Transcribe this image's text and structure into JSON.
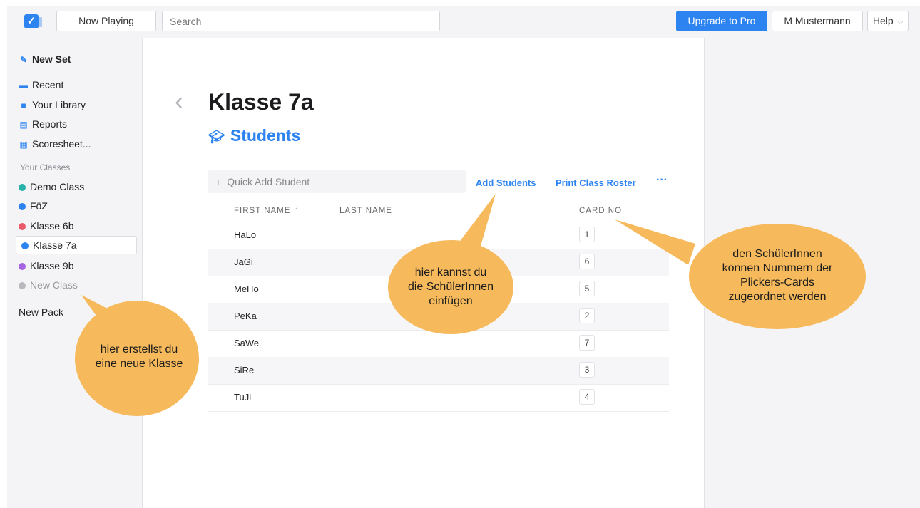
{
  "topbar": {
    "now_playing": "Now Playing",
    "search_placeholder": "Search",
    "upgrade": "Upgrade to Pro",
    "user": "M Mustermann",
    "help": "Help"
  },
  "sidebar": {
    "new_set": "New Set",
    "nav": [
      "Recent",
      "Your Library",
      "Reports",
      "Scoresheet..."
    ],
    "section_label": "Your Classes",
    "classes": [
      {
        "label": "Demo Class",
        "color": "#27b3a9"
      },
      {
        "label": "FöZ",
        "color": "#2d84f0"
      },
      {
        "label": "Klasse 6b",
        "color": "#ea5a6a"
      },
      {
        "label": "Klasse 7a",
        "color": "#2d84f0"
      },
      {
        "label": "Klasse 9b",
        "color": "#a764e0"
      }
    ],
    "new_class": "New Class",
    "new_pack": "New Pack"
  },
  "main": {
    "title": "Klasse 7a",
    "subtitle": "Students",
    "quick_add_placeholder": "Quick Add Student",
    "add_students": "Add Students",
    "print_roster": "Print Class Roster",
    "more": "···",
    "columns": {
      "first": "FIRST NAME",
      "last": "LAST NAME",
      "card": "CARD NO"
    },
    "students": [
      {
        "first": "HaLo",
        "card": "1"
      },
      {
        "first": "JaGi",
        "card": "6"
      },
      {
        "first": "MeHo",
        "card": "5"
      },
      {
        "first": "PeKa",
        "card": "2"
      },
      {
        "first": "SaWe",
        "card": "7"
      },
      {
        "first": "SiRe",
        "card": "3"
      },
      {
        "first": "TuJi",
        "card": "4"
      }
    ]
  },
  "annotations": {
    "new_class": [
      "hier erstellst du",
      "eine neue Klasse"
    ],
    "add_students": [
      "hier kannst du",
      "die SchülerInnen",
      "einfügen"
    ],
    "card_numbers": [
      "den SchülerInnen",
      "können Nummern der",
      "Plickers-Cards",
      "zugeordnet werden"
    ],
    "bubble_color": "#f6b95b"
  }
}
